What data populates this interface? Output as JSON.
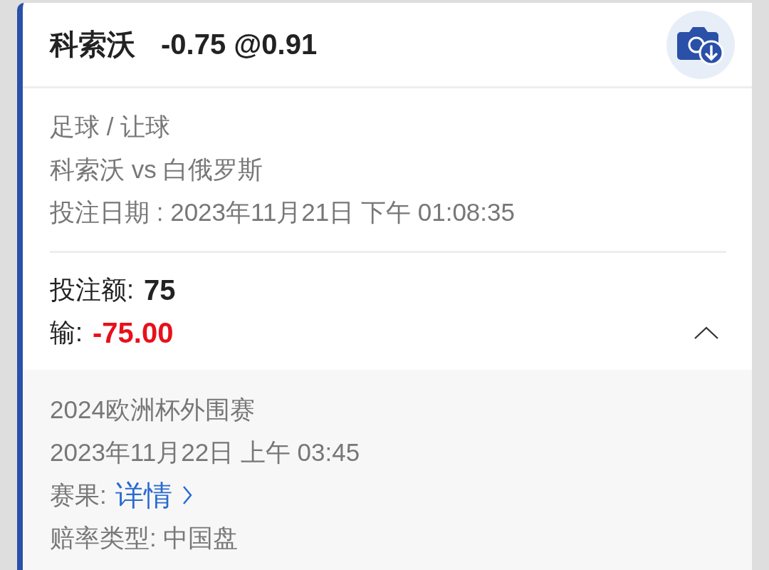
{
  "bet": {
    "selection": "科索沃",
    "odds_line": "-0.75 @0.91"
  },
  "info": [
    "足球 / 让球",
    "科索沃 vs 白俄罗斯",
    "投注日期 : 2023年11月21日 下午 01:08:35"
  ],
  "stake": {
    "label": "投注额:",
    "value": "75"
  },
  "result": {
    "label": "输:",
    "value": "-75.00",
    "loss": true
  },
  "details": {
    "expanded": true,
    "competition": "2024欧洲杯外围赛",
    "match_time": "2023年11月22日 上午 03:45",
    "score_label": "赛果:",
    "score_link": "详情",
    "odds_type": "赔率类型: 中国盘"
  }
}
